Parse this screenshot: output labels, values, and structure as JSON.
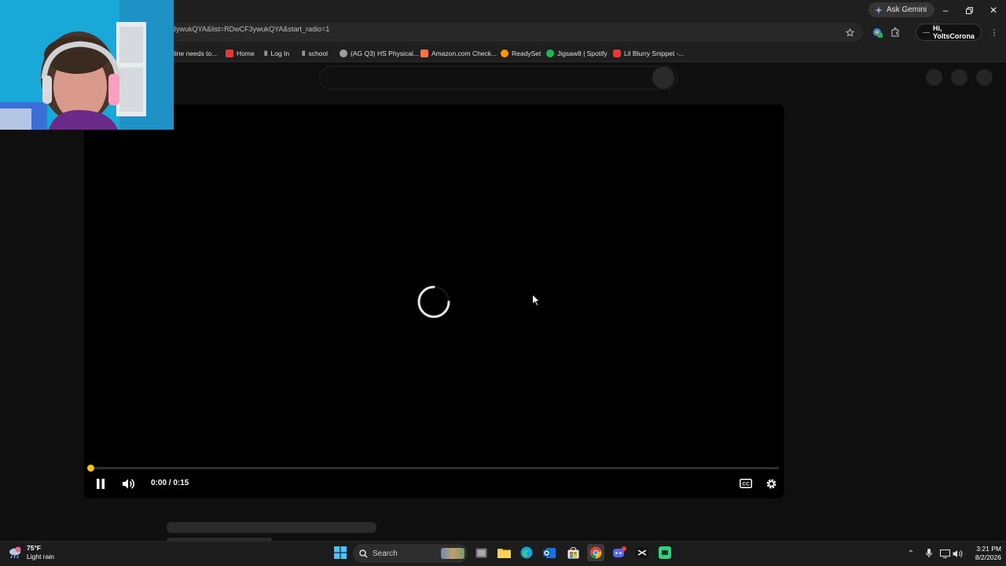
{
  "browser": {
    "gemini_label": "Ask Gemini",
    "url": "3ywukQYA&list=RDwCF3ywukQYA&start_radio=1",
    "profile_label": "Hi, YoltsCorona",
    "bookmarks": [
      {
        "label": "line needs to...",
        "color": "#9e9e9e"
      },
      {
        "label": "Home",
        "color": "#e53935"
      },
      {
        "label": "Log In",
        "color": "#ffffff"
      },
      {
        "label": "school",
        "color": "#ffffff"
      },
      {
        "label": "(AG Q3) HS Physical...",
        "color": "#bdbdbd"
      },
      {
        "label": "Amazon.com Check...",
        "color": "#ff7043"
      },
      {
        "label": "ReadySet",
        "color": "#ff9800"
      },
      {
        "label": "Jigsaw8 | Spotify",
        "color": "#1db954"
      },
      {
        "label": "Lil Blurry Snippet -...",
        "color": "#e53935"
      }
    ]
  },
  "player": {
    "time_display": "0:00 / 0:15",
    "progress_fraction": 0.0,
    "state": "loading",
    "accent_color": "#f5c518"
  },
  "taskbar": {
    "weather_temp": "75°F",
    "weather_desc": "Light rain",
    "search_label": "Search",
    "time": "3:21 PM",
    "date": "8/2/2026",
    "apps": [
      "windows-start-icon",
      "task-view-icon",
      "file-explorer-icon",
      "edge-icon",
      "outlook-icon",
      "store-icon",
      "chrome-icon",
      "discord-icon",
      "capcut-icon",
      "app-green-icon"
    ]
  }
}
